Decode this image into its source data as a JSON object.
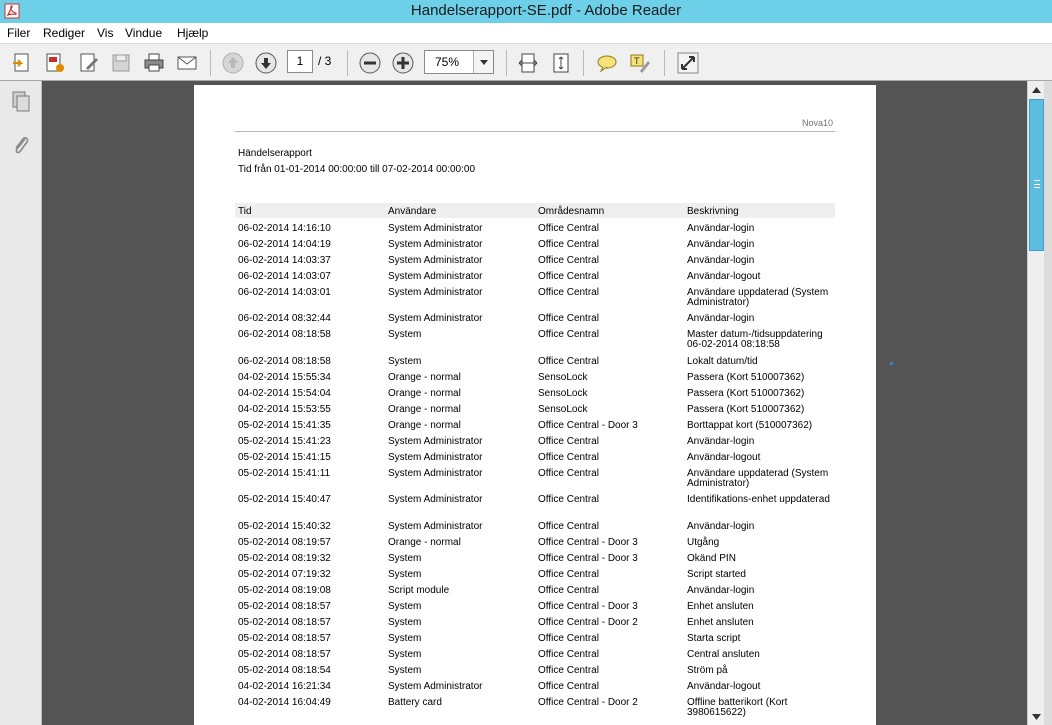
{
  "window": {
    "title": "Handelserapport-SE.pdf - Adobe Reader"
  },
  "menu": [
    "Filer",
    "Rediger",
    "Vis",
    "Vindue",
    "Hjælp"
  ],
  "toolbar": {
    "page_current": "1",
    "page_total": "/ 3",
    "zoom": "75%",
    "icons": [
      "create-pdf-icon",
      "export-pdf-icon",
      "edit-pdf-icon",
      "save-icon",
      "print-icon",
      "email-icon",
      "previous-page-icon",
      "next-page-icon",
      "zoom-out-icon",
      "zoom-in-icon",
      "fit-width-icon",
      "fit-page-icon",
      "comment-icon",
      "highlight-text-icon",
      "full-screen-icon"
    ]
  },
  "side_panel": {
    "icons": [
      "pages-icon",
      "attachments-icon"
    ]
  },
  "document": {
    "brand": "Nova10",
    "title": "Händelserapport",
    "subtitle": "Tid från 01-01-2014 00:00:00 till 07-02-2014 00:00:00",
    "columns": [
      "Tid",
      "Användare",
      "Områdesnamn",
      "Beskrivning"
    ],
    "rows": [
      [
        "06-02-2014 14:16:10",
        "System Administrator",
        "Office Central",
        "Användar-login"
      ],
      [
        "06-02-2014 14:04:19",
        "System Administrator",
        "Office Central",
        "Användar-login"
      ],
      [
        "06-02-2014 14:03:37",
        "System Administrator",
        "Office Central",
        "Användar-login"
      ],
      [
        "06-02-2014 14:03:07",
        "System Administrator",
        "Office Central",
        "Användar-logout"
      ],
      [
        "06-02-2014 14:03:01",
        "System Administrator",
        "Office Central",
        "Användare uppdaterad (System Administrator)"
      ],
      [
        "06-02-2014 08:32:44",
        "System Administrator",
        "Office Central",
        "Användar-login"
      ],
      [
        "06-02-2014 08:18:58",
        "System",
        "Office Central",
        "Master datum-/tidsuppdatering 06-02-2014 08:18:58"
      ],
      [
        "06-02-2014 08:18:58",
        "System",
        "Office Central",
        "Lokalt datum/tid"
      ],
      [
        "04-02-2014 15:55:34",
        "Orange - normal",
        "SensoLock",
        "Passera  (Kort 510007362)"
      ],
      [
        "04-02-2014 15:54:04",
        "Orange - normal",
        "SensoLock",
        "Passera  (Kort 510007362)"
      ],
      [
        "04-02-2014 15:53:55",
        "Orange - normal",
        "SensoLock",
        "Passera  (Kort 510007362)"
      ],
      [
        "05-02-2014 15:41:35",
        "Orange - normal",
        "Office Central - Door 3",
        "Borttappat kort (510007362)"
      ],
      [
        "05-02-2014 15:41:23",
        "System Administrator",
        "Office Central",
        "Användar-login"
      ],
      [
        "05-02-2014 15:41:15",
        "System Administrator",
        "Office Central",
        "Användar-logout"
      ],
      [
        "05-02-2014 15:41:11",
        "System Administrator",
        "Office Central",
        "Användare uppdaterad (System Administrator)"
      ],
      [
        "05-02-2014 15:40:47",
        "System Administrator",
        "Office Central",
        "Identifikations-enhet uppdaterad"
      ],
      [
        "05-02-2014 15:40:32",
        "System Administrator",
        "Office Central",
        "Användar-login"
      ],
      [
        "05-02-2014 08:19:57",
        "Orange - normal",
        "Office Central - Door 3",
        "Utgång"
      ],
      [
        "05-02-2014 08:19:32",
        "System",
        "Office Central - Door 3",
        "Okänd PIN"
      ],
      [
        "05-02-2014 07:19:32",
        "System",
        "Office Central",
        "Script started"
      ],
      [
        "05-02-2014 08:19:08",
        "Script module",
        "Office Central",
        "Användar-login"
      ],
      [
        "05-02-2014 08:18:57",
        "System",
        "Office Central - Door 3",
        "Enhet ansluten"
      ],
      [
        "05-02-2014 08:18:57",
        "System",
        "Office Central - Door 2",
        "Enhet ansluten"
      ],
      [
        "05-02-2014 08:18:57",
        "System",
        "Office Central",
        "Starta script"
      ],
      [
        "05-02-2014 08:18:57",
        "System",
        "Office Central",
        "Central ansluten"
      ],
      [
        "05-02-2014 08:18:54",
        "System",
        "Office Central",
        "Ström på"
      ],
      [
        "04-02-2014 16:21:34",
        "System Administrator",
        "Office Central",
        "Användar-logout"
      ],
      [
        "04-02-2014 16:04:49",
        "Battery card",
        "Office Central - Door 2",
        "Offline batterikort  (Kort 3980615622)"
      ]
    ]
  }
}
